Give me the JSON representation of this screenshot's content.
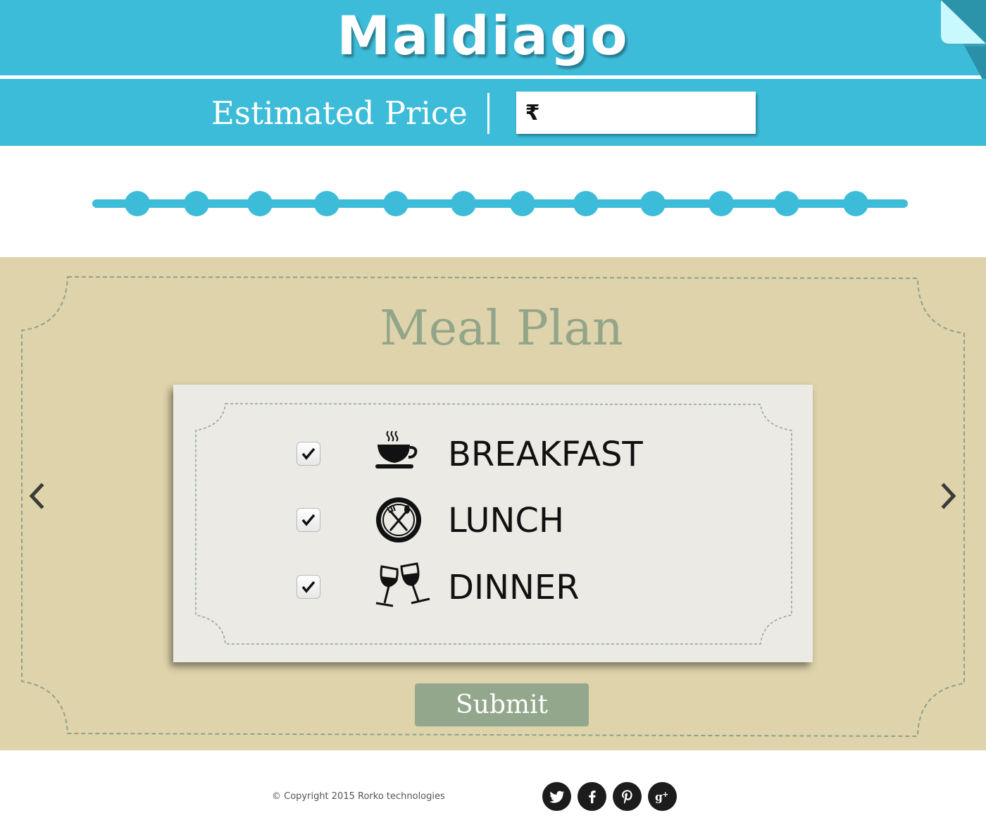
{
  "brand": {
    "name": "Maldiago"
  },
  "price": {
    "label": "Estimated Price",
    "currency_symbol": "₹",
    "value": ""
  },
  "stepper": {
    "step_count": 12,
    "color": "#3dbcd9"
  },
  "meal_plan": {
    "title": "Meal Plan",
    "items": [
      {
        "label": "BREAKFAST",
        "checked": true,
        "icon": "coffee-cup-icon"
      },
      {
        "label": "LUNCH",
        "checked": true,
        "icon": "plate-fork-knife-icon"
      },
      {
        "label": "DINNER",
        "checked": true,
        "icon": "wine-glasses-icon"
      }
    ],
    "submit_label": "Submit",
    "prev_icon": "chevron-left-icon",
    "next_icon": "chevron-right-icon"
  },
  "footer": {
    "copyright": "© Copyright 2015 Rorko technologies",
    "social": [
      "twitter-icon",
      "facebook-icon",
      "pinterest-icon",
      "google-plus-icon"
    ]
  },
  "colors": {
    "header": "#3dbcd9",
    "meal_background": "#ded3ab",
    "accent_green": "#92a78b",
    "card": "#ebeae5"
  }
}
